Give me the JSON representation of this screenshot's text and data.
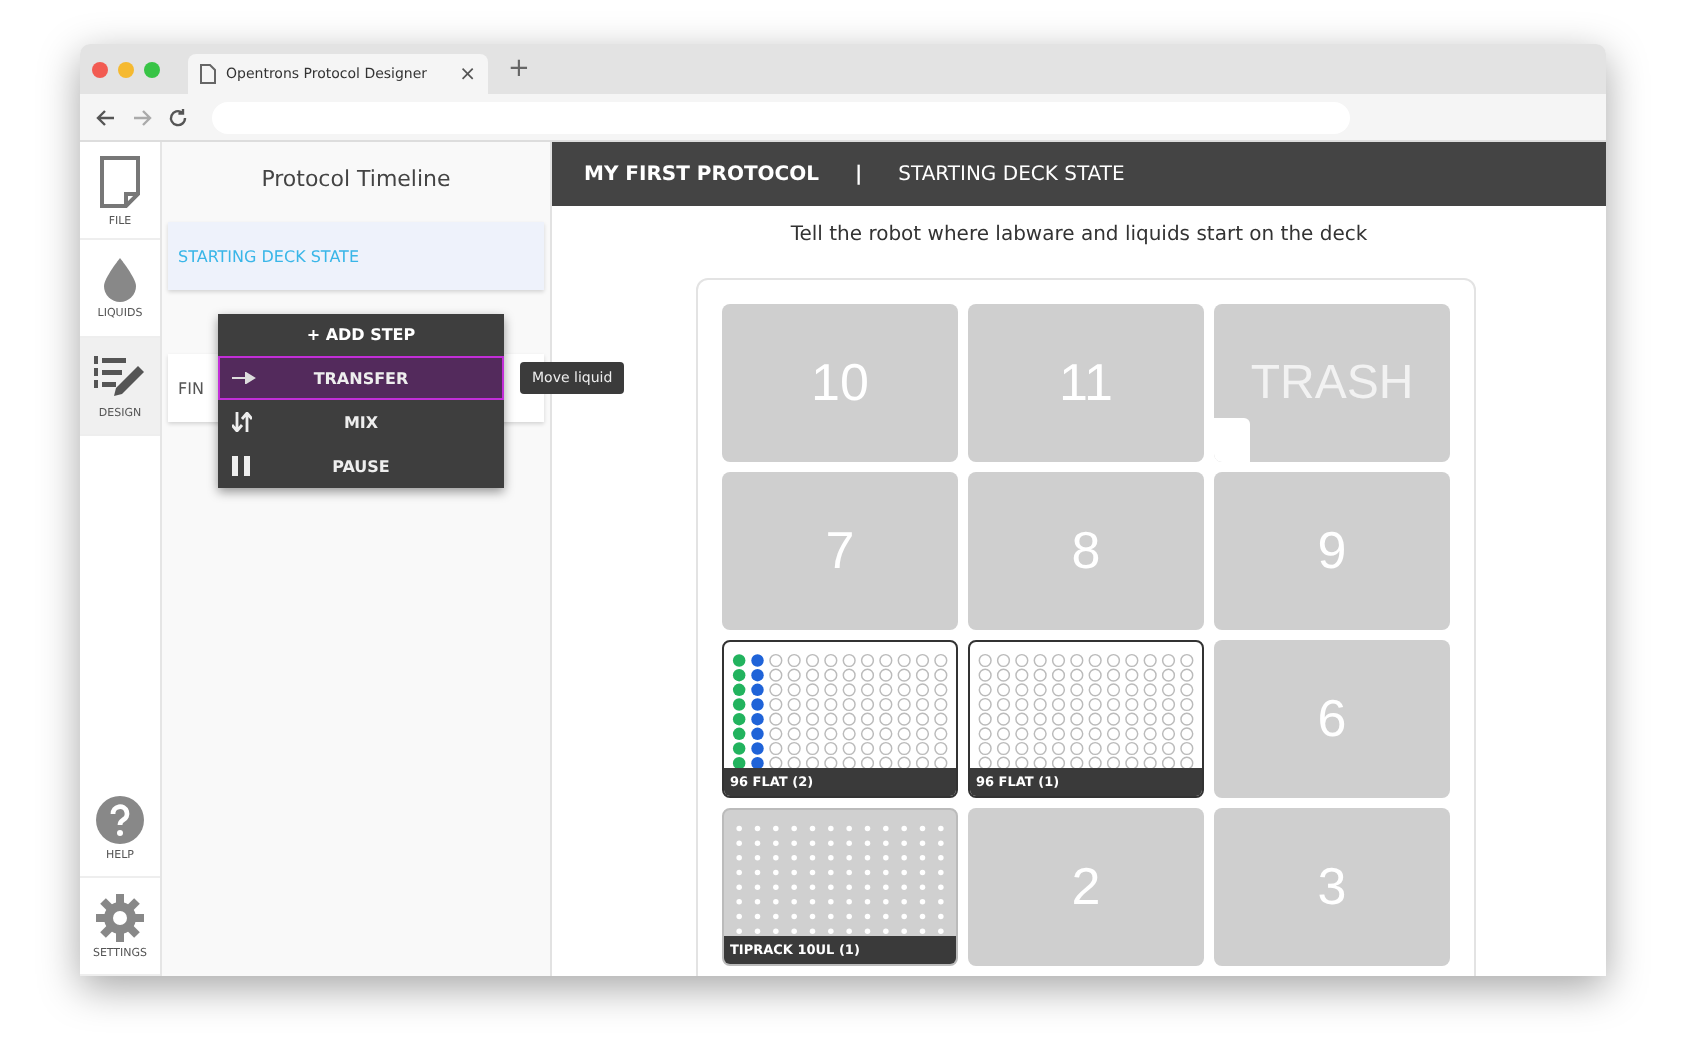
{
  "browser": {
    "tab_title": "Opentrons Protocol Designer",
    "tab_close": "×",
    "new_tab": "+"
  },
  "nav": [
    {
      "kind": "file",
      "label": "FILE",
      "selected": false
    },
    {
      "kind": "liquids",
      "label": "LIQUIDS",
      "selected": false
    },
    {
      "kind": "design",
      "label": "DESIGN",
      "selected": true
    }
  ],
  "nav_bottom": [
    {
      "kind": "help",
      "label": "HELP"
    },
    {
      "kind": "settings",
      "label": "SETTINGS"
    }
  ],
  "timeline": {
    "title": "Protocol Timeline",
    "items": [
      {
        "label": "STARTING DECK STATE",
        "selected": true
      },
      {
        "label": "FIN",
        "selected": false
      }
    ]
  },
  "step_menu": {
    "header": "+ ADD STEP",
    "items": [
      {
        "kind": "transfer",
        "label": "TRANSFER",
        "selected": true
      },
      {
        "kind": "mix",
        "label": "MIX",
        "selected": false
      },
      {
        "kind": "pause",
        "label": "PAUSE",
        "selected": false
      }
    ],
    "tooltip": "Move liquid"
  },
  "header": {
    "protocol": "MY FIRST PROTOCOL",
    "separator": "|",
    "section": "STARTING DECK STATE"
  },
  "instruction": "Tell the robot where labware and liquids start on the deck",
  "deck": [
    {
      "kind": "empty",
      "label": "10"
    },
    {
      "kind": "empty",
      "label": "11"
    },
    {
      "kind": "trash",
      "label": "TRASH"
    },
    {
      "kind": "empty",
      "label": "7"
    },
    {
      "kind": "empty",
      "label": "8"
    },
    {
      "kind": "empty",
      "label": "9"
    },
    {
      "kind": "plate",
      "label": "96 FLAT (2)",
      "liquids": [
        {
          "color": "#22b35e"
        },
        {
          "color": "#1f63d8"
        }
      ]
    },
    {
      "kind": "plate",
      "label": "96 FLAT (1)"
    },
    {
      "kind": "empty",
      "label": "6"
    },
    {
      "kind": "tiprack",
      "label": "TIPRACK 10UL (1)"
    },
    {
      "kind": "empty",
      "label": "2"
    },
    {
      "kind": "empty",
      "label": "3"
    }
  ]
}
